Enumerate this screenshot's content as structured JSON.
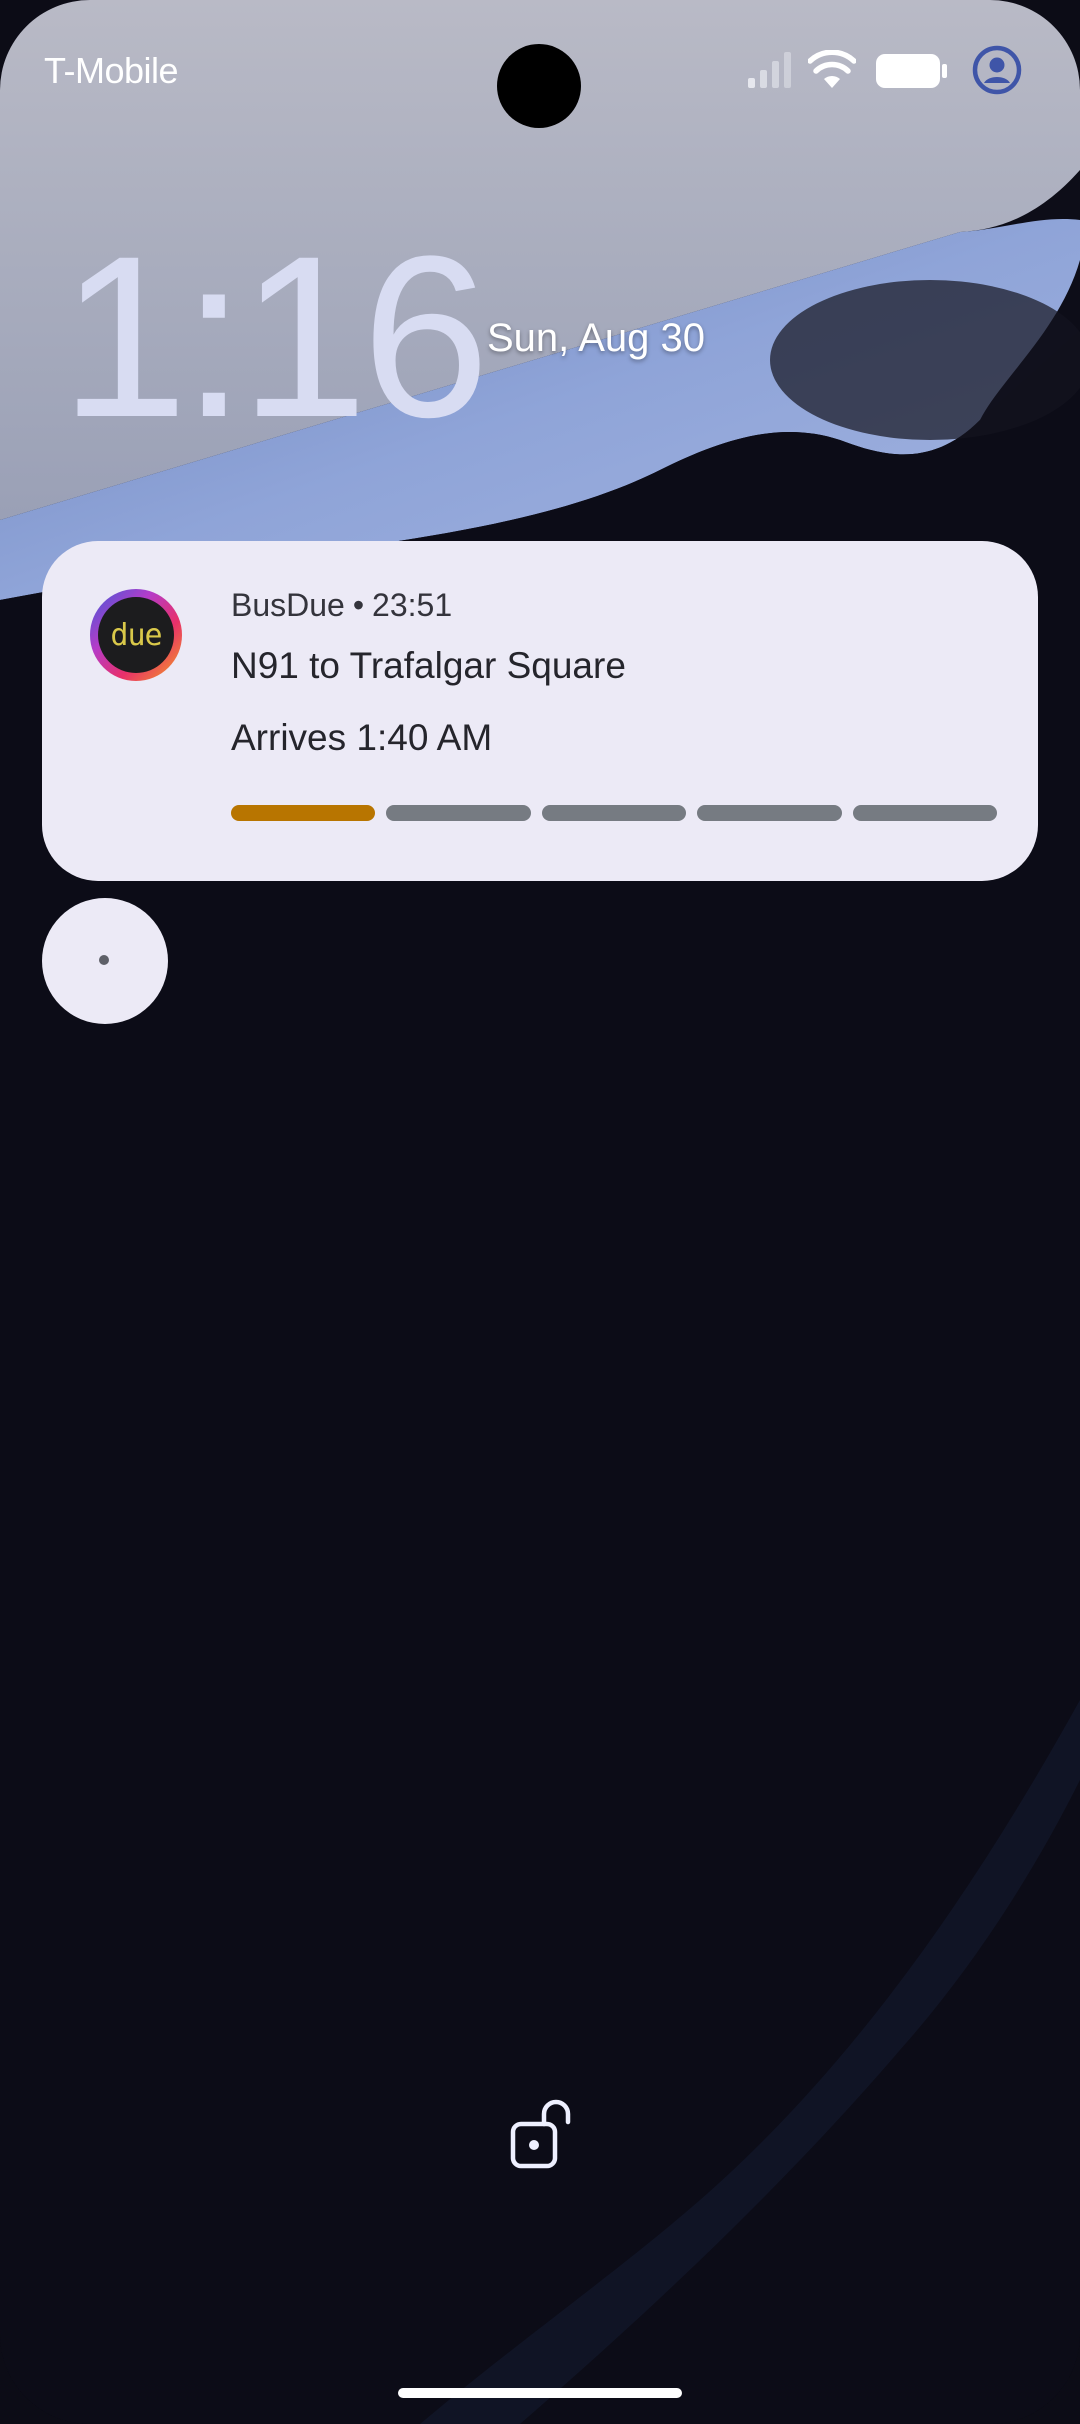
{
  "status_bar": {
    "carrier": "T-Mobile",
    "icons": [
      "signal-icon",
      "wifi-icon",
      "battery-icon",
      "account-icon"
    ]
  },
  "lockscreen": {
    "clock": "1:16",
    "date": "Sun, Aug 30"
  },
  "notification": {
    "app_name": "BusDue",
    "separator": "•",
    "time": "23:51",
    "title": "N91 to Trafalgar Square",
    "text": "Arrives 1:40 AM",
    "logo_text": "due",
    "progress": {
      "total_segments": 5,
      "completed_segments": 1
    }
  },
  "colors": {
    "progress_active": "#b87500",
    "progress_inactive": "#767b82",
    "card_background": "#eceaf6",
    "logo_text": "#d9c84a"
  },
  "bottom": {
    "icons": [
      "lock-open-icon"
    ]
  }
}
